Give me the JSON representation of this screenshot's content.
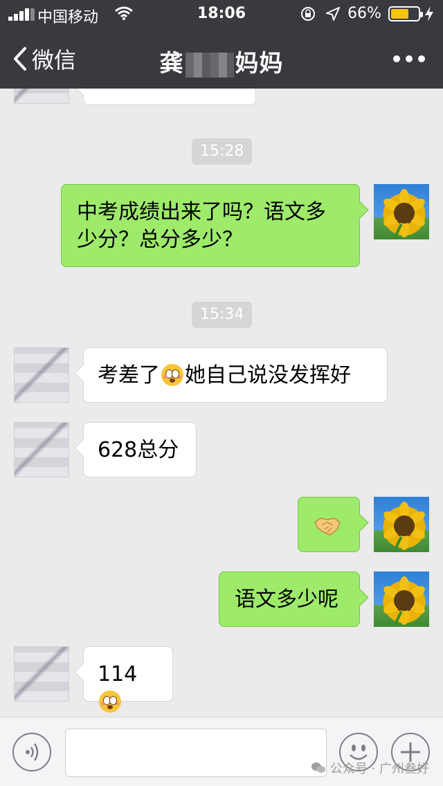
{
  "status_bar": {
    "carrier": "中国移动",
    "time": "18:06",
    "battery_percent": "66%",
    "battery_level": 0.66,
    "battery_color": "#f6c400"
  },
  "nav": {
    "back_label": "微信",
    "title_prefix": "龚",
    "title_suffix": "妈妈",
    "more_icon": "more-dots-icon"
  },
  "messages": [
    {
      "type": "time",
      "text": "15:28"
    },
    {
      "type": "outgoing",
      "text": "中考成绩出来了吗？语文多少分？总分多少？"
    },
    {
      "type": "time",
      "text": "15:34"
    },
    {
      "type": "incoming",
      "text_before": "考差了",
      "emoji": "flushed-face-emoji",
      "text_after": "她自己说没发挥好"
    },
    {
      "type": "incoming",
      "text": "628总分"
    },
    {
      "type": "outgoing",
      "emoji": "handshake-emoji"
    },
    {
      "type": "outgoing",
      "text": "语文多少呢"
    },
    {
      "type": "incoming",
      "text": "114",
      "emoji": "flushed-face-emoji"
    }
  ],
  "colors": {
    "top_bar": "#393a3f",
    "chat_bg": "#ebebeb",
    "outgoing_bubble": "#9eea6a",
    "incoming_bubble": "#ffffff"
  },
  "bottom": {
    "voice_icon": "voice-icon",
    "emoji_icon": "smiley-icon",
    "plus_icon": "plus-icon",
    "watermark": "公众号 · 广州叁好"
  }
}
